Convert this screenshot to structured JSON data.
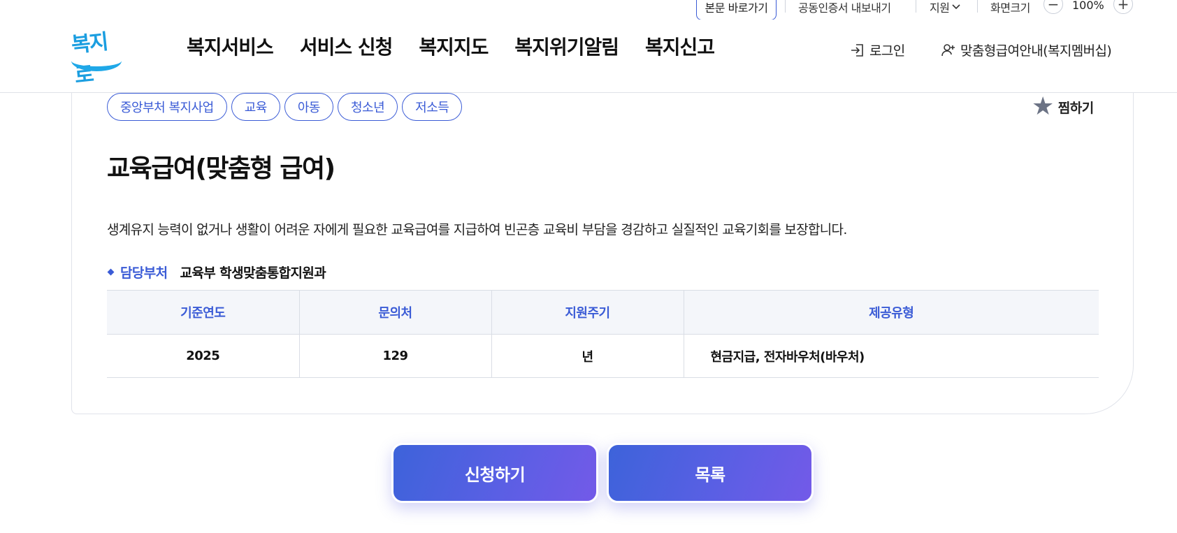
{
  "utility": {
    "skip_link": "본문 바로가기",
    "cert_export": "공동인증서 내보내기",
    "language": "지원",
    "screen_size_label": "화면크기",
    "zoom_minus": "−",
    "zoom_value": "100%",
    "zoom_plus": "+"
  },
  "header": {
    "logo_text": "복지로",
    "nav": [
      "복지서비스",
      "서비스 신청",
      "복지지도",
      "복지위기알림",
      "복지신고"
    ],
    "login": "로그인",
    "membership": "맞춤형급여안내(복지멤버십)"
  },
  "service": {
    "tags": [
      "중앙부처 복지사업",
      "교육",
      "아동",
      "청소년",
      "저소득"
    ],
    "favorite": "찜하기",
    "title": "교육급여(맞춤형 급여)",
    "description": "생계유지 능력이 없거나 생활이 어려운 자에게 필요한 교육급여를 지급하여 빈곤층 교육비 부담을 경감하고 실질적인 교육기회를 보장합니다.",
    "department_label": "담당부처",
    "department_value": "교육부 학생맞춤통합지원과",
    "table": {
      "headers": [
        "기준연도",
        "문의처",
        "지원주기",
        "제공유형"
      ],
      "row": [
        "2025",
        "129",
        "년",
        "현금지급, 전자바우처(바우처)"
      ]
    }
  },
  "actions": {
    "apply": "신청하기",
    "list": "목록"
  },
  "colors": {
    "accent": "#3a5bd6",
    "logo": "#1b9ee0",
    "button_gradient_start": "#3d63da",
    "button_gradient_end": "#735ae8"
  }
}
